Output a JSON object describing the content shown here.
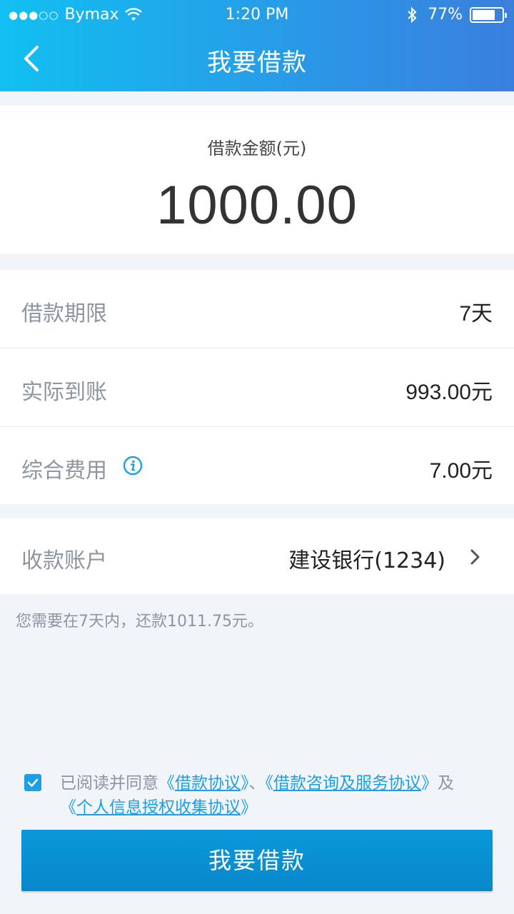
{
  "status_bar": {
    "signal": "●●●○○",
    "carrier": "Bymax",
    "time": "1:20 PM",
    "battery_percent": "77%",
    "battery_level": 0.77
  },
  "nav": {
    "title": "我要借款"
  },
  "amount": {
    "label": "借款金额(元)",
    "value": "1000.00"
  },
  "details": [
    {
      "label": "借款期限",
      "value": "7天"
    },
    {
      "label": "实际到账",
      "value": "993.00元"
    },
    {
      "label": "综合费用",
      "value": "7.00元"
    }
  ],
  "account": {
    "label": "收款账户",
    "value": "建设银行(1234)"
  },
  "notice": "您需要在7天内，还款1011.75元。",
  "agreement": {
    "prefix": "已阅读并同意",
    "open_quote": "《",
    "close_quote": "》",
    "link1": "借款协议",
    "sep": "、",
    "link2": "借款咨询及服务协议",
    "and": "及",
    "link3": "个人信息授权收集协议",
    "checked": true
  },
  "submit_label": "我要借款",
  "colors": {
    "accent": "#1f9fe3",
    "button": "#0a98db",
    "label_gray": "#8c95a0"
  }
}
